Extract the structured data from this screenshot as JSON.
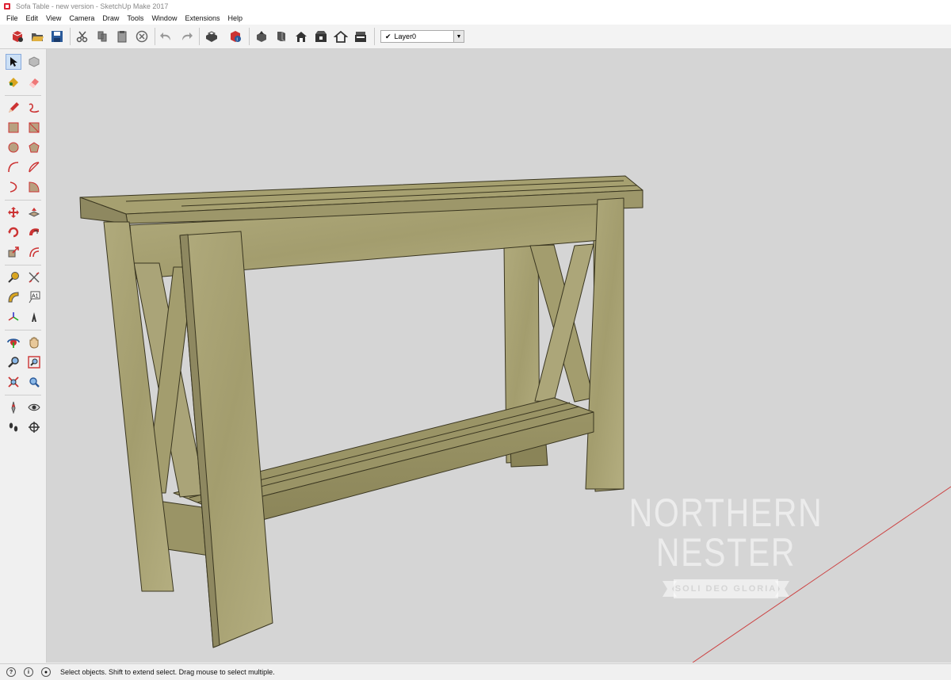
{
  "window": {
    "title": "Sofa Table - new version - SketchUp Make 2017"
  },
  "menu": [
    "File",
    "Edit",
    "View",
    "Camera",
    "Draw",
    "Tools",
    "Window",
    "Extensions",
    "Help"
  ],
  "toolbar": {
    "layer_select": {
      "value": "Layer0"
    }
  },
  "watermark": {
    "title": "NORTHERN NESTER",
    "banner": "SOLI DEO GLORIA"
  },
  "status": {
    "text": "Select objects. Shift to extend select. Drag mouse to select multiple."
  },
  "colors": {
    "viewport": "#d5d5d5",
    "wood": "#a8a374",
    "wood_dark": "#8a8458",
    "axis": "#c44"
  }
}
